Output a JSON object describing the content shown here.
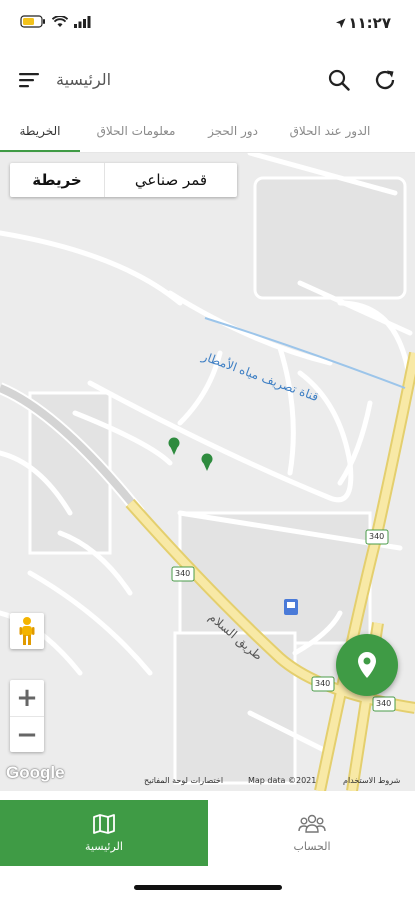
{
  "status_bar": {
    "time": "١١:٢٧"
  },
  "app_bar": {
    "title": "الرئيسية"
  },
  "tabs": [
    {
      "label": "الدور عند الحلاق"
    },
    {
      "label": "دور الحجز"
    },
    {
      "label": "معلومات الحلاق"
    },
    {
      "label": "الخريطة"
    }
  ],
  "map": {
    "map_type": {
      "map_label": "خريطة",
      "satellite_label": "قمر صناعي"
    },
    "labels": {
      "channel": "قناة تصريف مياه الأمطار",
      "road": "طريق السلام",
      "route_340": "340"
    },
    "zoom": {
      "in": "+",
      "out": "−"
    },
    "attribution": {
      "logo": "Google",
      "shortcuts": "اختصارات لوحة المفاتيح",
      "map_data": "Map data ©2021",
      "terms": "شروط الاستخدام"
    }
  },
  "bottom_nav": [
    {
      "label": "الرئيسية",
      "icon": "map-icon",
      "active": true
    },
    {
      "label": "الحساب",
      "icon": "people-icon",
      "active": false
    }
  ],
  "colors": {
    "accent": "#3f9b45",
    "map_bg": "#ececec",
    "road_yellow": "#f6e59a"
  }
}
